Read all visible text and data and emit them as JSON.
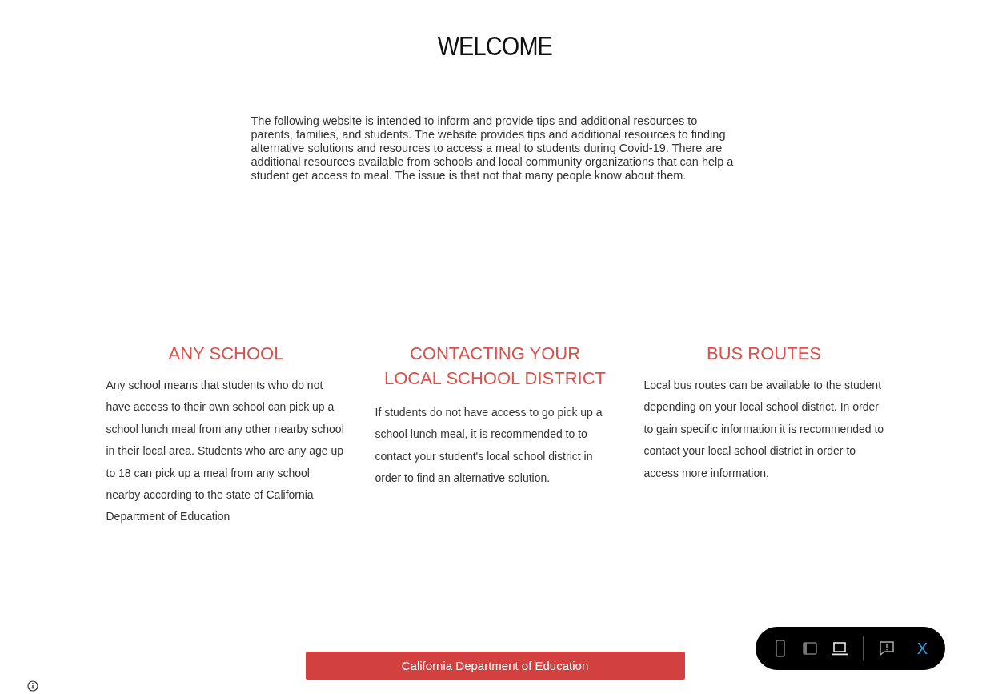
{
  "title": "WELCOME",
  "intro": "The following website is intended to inform and provide tips and additional resources to parents, families, and students. The website provides tips and additional resources to finding alternative solutions and resources to access a meal to students during Covid-19. There are additional resources available from schools and local community organizations that can help a student get access to meal. The issue is that not that many people know about them.",
  "sections": [
    {
      "heading": "ANY SCHOOL",
      "body": "Any school means that students who do not have access to their own school can pick up a school lunch meal from any other nearby school in their local area. Students who are any age up to 18  can pick up a meal from any school nearby according to the state of California Department of Education"
    },
    {
      "heading": "CONTACTING YOUR LOCAL SCHOOL DISTRICT",
      "body": "If students do not have access to go pick up a school lunch meal, it is recommended to to contact your student's local school district in order to find an alternative solution."
    },
    {
      "heading": "BUS ROUTES",
      "body": "Local bus routes can be available to the student depending on your local school district. In order to gain specific information it is recommended to contact your local school district in order to access more information."
    }
  ],
  "link_button": "California Department of Education",
  "preview_toolbar": {
    "devices": [
      {
        "kind": "mobile",
        "selected": false
      },
      {
        "kind": "tablet",
        "selected": false
      },
      {
        "kind": "desktop",
        "selected": true
      }
    ],
    "close": "X"
  }
}
